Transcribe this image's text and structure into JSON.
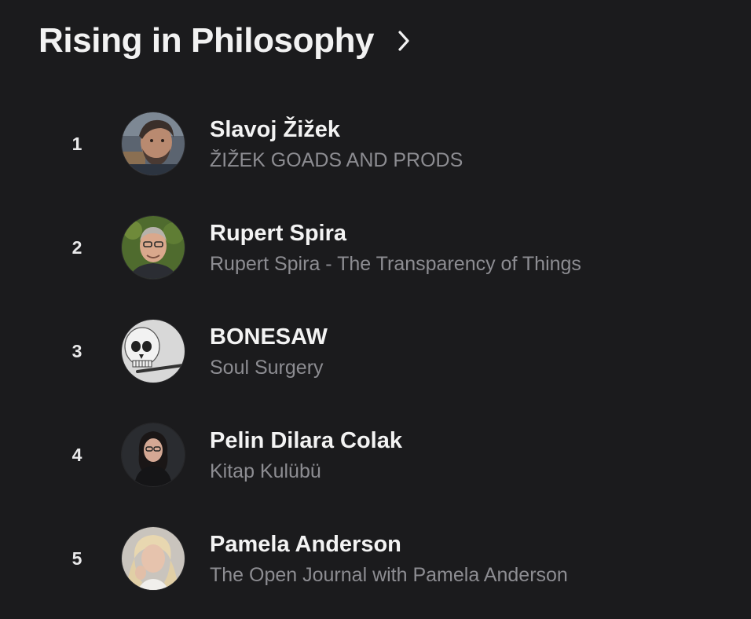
{
  "header": {
    "title": "Rising in Philosophy",
    "chevron_icon": "chevron-right-icon"
  },
  "items": [
    {
      "rank": "1",
      "name": "Slavoj Žižek",
      "subtitle": "ŽIŽEK GOADS AND PRODS",
      "avatar_icon": "creator-avatar"
    },
    {
      "rank": "2",
      "name": "Rupert Spira",
      "subtitle": "Rupert Spira - The Transparency of Things",
      "avatar_icon": "creator-avatar"
    },
    {
      "rank": "3",
      "name": "BONESAW",
      "subtitle": "Soul Surgery",
      "avatar_icon": "skull-avatar"
    },
    {
      "rank": "4",
      "name": "Pelin Dilara Colak",
      "subtitle": "Kitap Kulübü",
      "avatar_icon": "creator-avatar"
    },
    {
      "rank": "5",
      "name": "Pamela Anderson",
      "subtitle": "The Open Journal with Pamela Anderson",
      "avatar_icon": "creator-avatar"
    }
  ]
}
